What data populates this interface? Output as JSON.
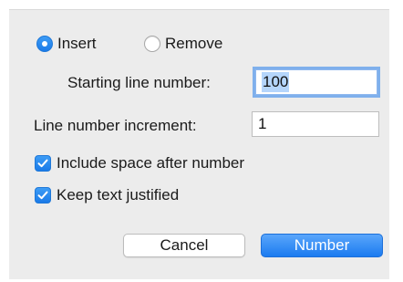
{
  "mode": {
    "options": [
      {
        "label": "Insert",
        "selected": true
      },
      {
        "label": "Remove",
        "selected": false
      }
    ]
  },
  "starting_line": {
    "label": "Starting line number:",
    "value": "100"
  },
  "increment": {
    "label": "Line number increment:",
    "value": "1"
  },
  "options": {
    "include_space": {
      "label": "Include space after number",
      "checked": true
    },
    "keep_justified": {
      "label": "Keep text justified",
      "checked": true
    }
  },
  "buttons": {
    "cancel": "Cancel",
    "confirm": "Number"
  },
  "colors": {
    "accent": "#1a7ae8",
    "panel": "#ececec",
    "focus_ring": "#7fb0ec",
    "selection": "#b5d5fb"
  }
}
